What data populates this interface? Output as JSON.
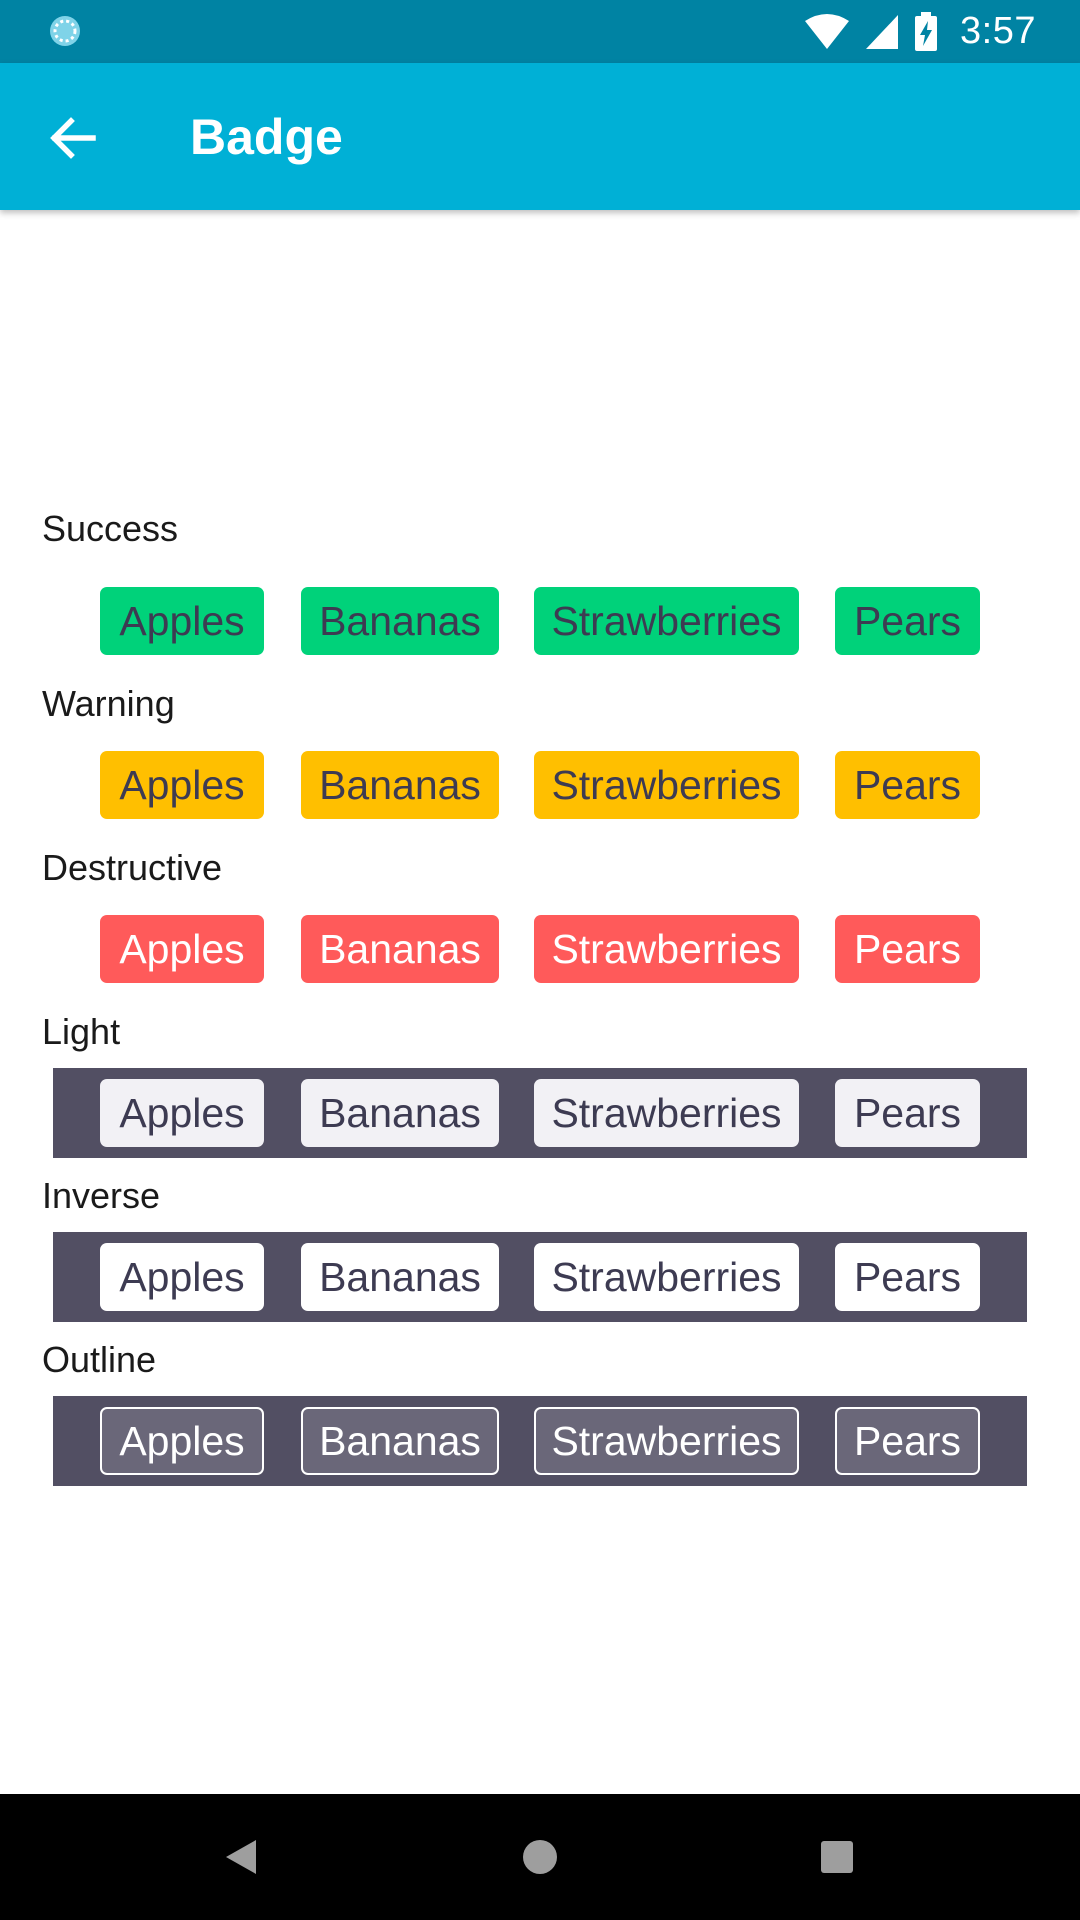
{
  "status_bar": {
    "time": "3:57",
    "icons": [
      "sync-icon",
      "wifi-icon",
      "signal-icon",
      "battery-charging-icon"
    ],
    "background": "#0083a3"
  },
  "app_bar": {
    "title": "Badge",
    "back_icon": "arrow-left-icon",
    "background": "#00b0d6"
  },
  "sections": [
    {
      "label": "Success",
      "badges": [
        "Apples",
        "Bananas",
        "Strawberries",
        "Pears"
      ],
      "color": "#00d27a"
    },
    {
      "label": "Warning",
      "badges": [
        "Apples",
        "Bananas",
        "Strawberries",
        "Pears"
      ],
      "color": "#ffbf00"
    },
    {
      "label": "Destructive",
      "badges": [
        "Apples",
        "Bananas",
        "Strawberries",
        "Pears"
      ],
      "color": "#ff5a5a"
    },
    {
      "label": "Light",
      "badges": [
        "Apples",
        "Bananas",
        "Strawberries",
        "Pears"
      ],
      "color": "#f2f1f5"
    },
    {
      "label": "Inverse",
      "badges": [
        "Apples",
        "Bananas",
        "Strawberries",
        "Pears"
      ],
      "color": "#ffffff"
    },
    {
      "label": "Outline",
      "badges": [
        "Apples",
        "Bananas",
        "Strawberries",
        "Pears"
      ],
      "color": "#6a6779"
    }
  ],
  "dark_row_background": "#524f63",
  "nav_bar": {
    "buttons": [
      "back-triangle-icon",
      "home-circle-icon",
      "recents-square-icon"
    ]
  }
}
